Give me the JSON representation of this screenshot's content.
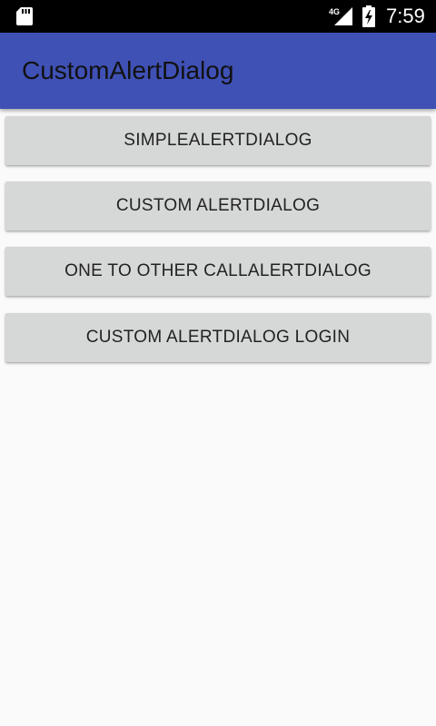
{
  "status_bar": {
    "network": "4G",
    "time": "7:59"
  },
  "app_bar": {
    "title": "CustomAlertDialog"
  },
  "buttons": [
    {
      "label": "SIMPLEALERTDIALOG"
    },
    {
      "label": "CUSTOM ALERTDIALOG"
    },
    {
      "label": "ONE TO OTHER CALLALERTDIALOG"
    },
    {
      "label": "CUSTOM ALERTDIALOG LOGIN"
    }
  ],
  "colors": {
    "primary": "#3f51b5",
    "status_bar": "#000000",
    "background": "#fafafa",
    "button": "#d6d7d7"
  },
  "icons": [
    "sd-card-icon",
    "cell-signal-icon",
    "battery-charging-icon"
  ]
}
